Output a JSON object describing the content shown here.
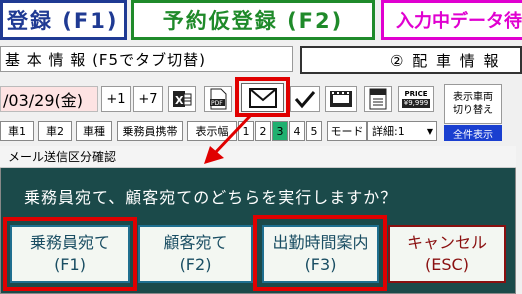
{
  "top_buttons": {
    "register": "登録 (F1)",
    "provisional": "予約仮登録 (F2)",
    "input_data": "入力中データ待"
  },
  "info": {
    "basic": "基 本 情 報 (F5でタブ切替)",
    "dispatch": "② 配 車 情 報"
  },
  "toolbar": {
    "date": "/03/29(金)",
    "plus1": "+1",
    "plus7": "+7",
    "price_label": "PRICE",
    "price_value": "¥9,999",
    "display_switch_line1": "表示車両",
    "display_switch_line2": "切り替え",
    "show_all": "全件表示"
  },
  "tabs": {
    "car1": "車1",
    "car2": "車2",
    "car_type": "車種",
    "crew_mobile": "乗務員携帯",
    "display_width": "表示幅",
    "n1": "1",
    "n2": "2",
    "n3": "3",
    "n4": "4",
    "n5": "5",
    "mode": "モード",
    "detail": "詳細:1"
  },
  "dialog": {
    "title": "メール送信区分確認",
    "message": "乗務員宛て、顧客宛てのどちらを実行しますか？",
    "buttons": [
      {
        "line1": "乗務員宛て",
        "line2": "(F1)"
      },
      {
        "line1": "顧客宛て",
        "line2": "(F2)"
      },
      {
        "line1": "出勤時間案内",
        "line2": "(F3)"
      },
      {
        "line1": "キャンセル",
        "line2": "(ESC)"
      }
    ]
  },
  "colors": {
    "accent_red": "#e00000",
    "dialog_bg": "#1b4a4a",
    "tab_active": "#20b070"
  }
}
